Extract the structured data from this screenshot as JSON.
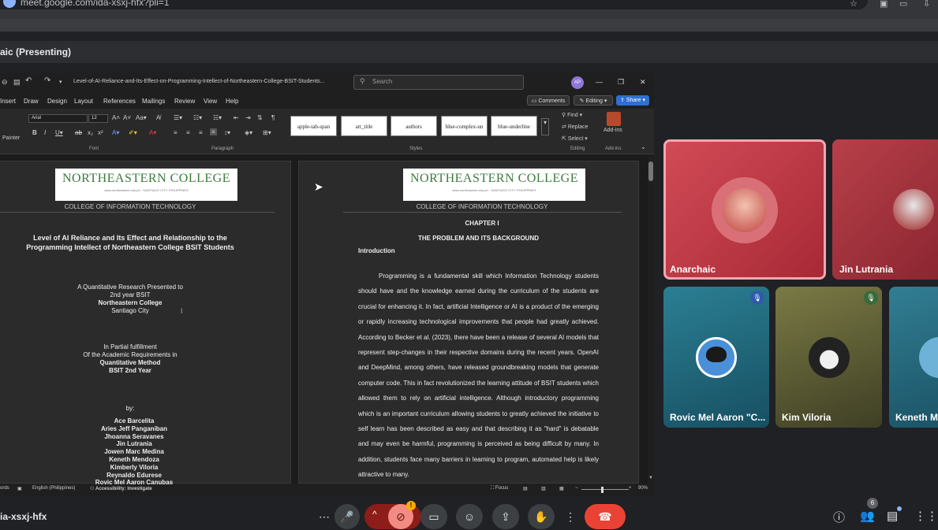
{
  "browser": {
    "url": "meet.google.com/ida-xsxj-hfx?pli=1",
    "icons": [
      "star-icon",
      "extension-icon",
      "window-icon",
      "download-icon",
      "more-icon"
    ]
  },
  "meet": {
    "presenting_title": "aic (Presenting)",
    "meeting_code": "ia-xsxj-hfx",
    "participants_badge": "6",
    "participants": [
      {
        "name": "Anarchaic",
        "highlighted": true,
        "color": "#c2303b"
      },
      {
        "name": "Jin Lutrania",
        "highlighted": false,
        "color": "#a32e35"
      },
      {
        "name": "Rovic Mel Aaron \"C...",
        "highlighted": false,
        "color": "#1e6d80"
      },
      {
        "name": "Kim Viloria",
        "highlighted": false,
        "color": "#6b6a3a"
      },
      {
        "name": "Keneth Me",
        "highlighted": false,
        "color": "#2b6b80"
      }
    ]
  },
  "word": {
    "doc_title": "Level-of-AI-Reliance-and-Its-Effect-on-Programming-Intellect-of-Northeastern-College-BSIT-Students...",
    "search_placeholder": "Search",
    "user_initials": "AP",
    "menu": [
      "Insert",
      "Draw",
      "Design",
      "Layout",
      "References",
      "Mailings",
      "Review",
      "View",
      "Help"
    ],
    "buttons": {
      "comments": "Comments",
      "editing": "Editing",
      "share": "Share"
    },
    "font_name": "Arial",
    "font_size": "12",
    "ribbon_groups": {
      "clipboard": "Painter",
      "font": "Font",
      "paragraph": "Paragraph",
      "styles": "Styles",
      "editing": "Editing",
      "addins": "Add-ins"
    },
    "styles": [
      "apple-tab-span",
      "art_title",
      "authors",
      "blue-complex-un",
      "blue-underline"
    ],
    "editing_items": [
      "Find",
      "Replace",
      "Select"
    ],
    "addins_label": "Add-ins",
    "status": {
      "words": "ords",
      "language": "English (Philippines)",
      "accessibility": "Accessibility: Investigate",
      "focus": "Focus",
      "zoom": "90%"
    }
  },
  "document": {
    "logo_text": "NORTHEASTERN COLLEGE",
    "logo_subtext": "www.northeastern.edu.ph · SANTIAGO CITY, PHILIPPINES",
    "dept": "COLLEGE OF INFORMATION TECHNOLOGY",
    "left_page": {
      "title_line1": "Level of AI Reliance and Its Effect and Relationship to the",
      "title_line2": "Programming Intellect of Northeastern College BSIT Students",
      "presented_to": "A Quantitative Research Presented to",
      "year": "2nd year BSIT",
      "college": "Northeastern College",
      "city": "Santiago City",
      "fulfillment": "In Partial fulfillment",
      "of_the": "Of the Academic Requirements in",
      "method": "Quantitative Method",
      "bsit": "BSIT 2nd Year",
      "by": "by:",
      "authors": [
        "Ace Barcelita",
        "Aries Jeff Panganiban",
        "Jhoanna Seravanes",
        "Jin Lutrania",
        "Jowen Marc Medina",
        "Keneth Mendoza",
        "Kimberly Viloria",
        "Reynaldo Edurese",
        "Rovic Mel Aaron Canubas"
      ]
    },
    "right_page": {
      "chapter": "CHAPTER I",
      "chapter_title": "THE PROBLEM AND ITS BACKGROUND",
      "section": "Introduction",
      "paragraph": "Programming is a fundamental skill which Information Technology students should have and the knowledge earned during the curriculum of the students are crucial for enhancing it. In fact, artificial Intelligence or AI is a product of the emerging or rapidly increasing technological improvements that people had greatly achieved. According to Becker et al. (2023), there have been a release of several AI models that represent step-changes in their respective domains during the recent years. OpenAI and DeepMind, among others, have released groundbreaking models that generate computer code. This in fact revolutionized the learning attitude of BSIT students which allowed them to rely on artificial intelligence. Although introductory programming which is an important curriculum allowing students to greatly achieved the initiative to self learn has been described as easy and that describing it as \"hard\" is debatable and may even be harmful, programming is perceived as being difficult by many. In addition, students face many barriers in learning to program, automated help is likely attractive to many."
    }
  },
  "controls": {
    "left_icons": [
      "more-horiz-icon",
      "mic-icon",
      "chevron-up-icon",
      "camera-off-icon",
      "captions-icon",
      "emoji-icon",
      "present-icon",
      "hand-icon",
      "more-vert-icon",
      "end-call-icon"
    ],
    "right_icons": [
      "info-icon",
      "people-icon",
      "chat-icon",
      "apps-icon"
    ],
    "warning_badge": "!"
  }
}
